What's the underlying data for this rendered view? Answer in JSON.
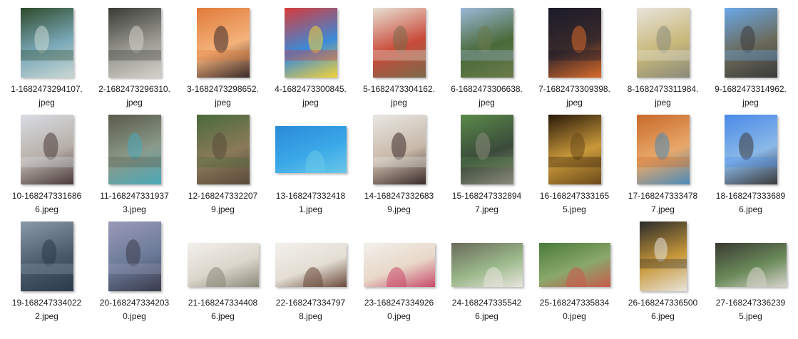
{
  "window": {
    "view": "large-icons"
  },
  "files": [
    {
      "line1": "1-1682473294107.",
      "line2": "jpeg",
      "shape": "portrait",
      "icon": "photo-thumbnail-icon",
      "colors": [
        "#2d4a2a",
        "#7aa8b8",
        "#c9d8d4"
      ]
    },
    {
      "line1": "2-1682473296310.",
      "line2": "jpeg",
      "shape": "portrait",
      "icon": "photo-thumbnail-icon",
      "colors": [
        "#3a3a36",
        "#9a9a92",
        "#d4d2ca"
      ]
    },
    {
      "line1": "3-1682473298652.",
      "line2": "jpeg",
      "shape": "portrait",
      "icon": "photo-thumbnail-icon",
      "colors": [
        "#e07a3a",
        "#f4b27a",
        "#3a2a2a"
      ]
    },
    {
      "line1": "4-1682473300845.",
      "line2": "jpeg",
      "shape": "portrait",
      "icon": "photo-thumbnail-icon",
      "colors": [
        "#d93a3a",
        "#3a8ad9",
        "#f2d23a"
      ]
    },
    {
      "line1": "5-1682473304162.",
      "line2": "jpeg",
      "shape": "portrait",
      "icon": "photo-thumbnail-icon",
      "colors": [
        "#e8e2d4",
        "#c94a3a",
        "#7a6a4a"
      ]
    },
    {
      "line1": "6-1682473306638.",
      "line2": "jpeg",
      "shape": "portrait",
      "icon": "photo-thumbnail-icon",
      "colors": [
        "#9ab8d8",
        "#4a6a3a",
        "#6a7a4a"
      ]
    },
    {
      "line1": "7-1682473309398.",
      "line2": "jpeg",
      "shape": "portrait",
      "icon": "photo-thumbnail-icon",
      "colors": [
        "#1a1a2a",
        "#3a2a2a",
        "#d96a2a"
      ]
    },
    {
      "line1": "8-1682473311984.",
      "line2": "jpeg",
      "shape": "portrait",
      "icon": "photo-thumbnail-icon",
      "colors": [
        "#e8e4dc",
        "#c8b87a",
        "#8a8a7a"
      ]
    },
    {
      "line1": "9-1682473314962.",
      "line2": "jpeg",
      "shape": "portrait",
      "icon": "photo-thumbnail-icon",
      "colors": [
        "#6aa8e8",
        "#6a6a5a",
        "#3a3a3a"
      ]
    },
    {
      "line1": "10-168247331686",
      "line2": "6.jpeg",
      "shape": "portrait",
      "icon": "photo-thumbnail-icon",
      "colors": [
        "#d8dce4",
        "#b8b0a8",
        "#4a3a3a"
      ]
    },
    {
      "line1": "11-168247331937",
      "line2": "3.jpeg",
      "shape": "portrait",
      "icon": "photo-thumbnail-icon",
      "colors": [
        "#5a5a4a",
        "#8a9a8a",
        "#4aa8b8"
      ]
    },
    {
      "line1": "12-168247332207",
      "line2": "9.jpeg",
      "shape": "portrait",
      "icon": "photo-thumbnail-icon",
      "colors": [
        "#4a6a3a",
        "#8a7a5a",
        "#5a4a3a"
      ]
    },
    {
      "line1": "13-168247332418",
      "line2": "1.jpeg",
      "shape": "landscape",
      "icon": "photo-thumbnail-icon",
      "colors": [
        "#2a8ad8",
        "#3aa8e8",
        "#6ac8e8"
      ]
    },
    {
      "line1": "14-168247332683",
      "line2": "9.jpeg",
      "shape": "portrait",
      "icon": "photo-thumbnail-icon",
      "colors": [
        "#e8e8e4",
        "#c8b8a8",
        "#3a2a2a"
      ]
    },
    {
      "line1": "15-168247332894",
      "line2": "7.jpeg",
      "shape": "portrait",
      "icon": "photo-thumbnail-icon",
      "colors": [
        "#5a8a4a",
        "#3a4a3a",
        "#8a8a7a"
      ]
    },
    {
      "line1": "16-168247333165",
      "line2": "5.jpeg",
      "shape": "portrait",
      "icon": "photo-thumbnail-icon",
      "colors": [
        "#2a1a0a",
        "#c8983a",
        "#6a4a1a"
      ]
    },
    {
      "line1": "17-168247333478",
      "line2": "7.jpeg",
      "shape": "portrait",
      "icon": "photo-thumbnail-icon",
      "colors": [
        "#c86a2a",
        "#e8a86a",
        "#4a8ab8"
      ]
    },
    {
      "line1": "18-168247333689",
      "line2": "6.jpeg",
      "shape": "portrait",
      "icon": "photo-thumbnail-icon",
      "colors": [
        "#4a8ae8",
        "#8ab8e8",
        "#3a3a3a"
      ]
    },
    {
      "line1": "19-168247334022",
      "line2": "2.jpeg",
      "shape": "portrait",
      "icon": "photo-thumbnail-icon",
      "colors": [
        "#8a9aa8",
        "#4a5a6a",
        "#2a3a4a"
      ]
    },
    {
      "line1": "20-168247334203",
      "line2": "0.jpeg",
      "shape": "portrait",
      "icon": "photo-thumbnail-icon",
      "colors": [
        "#9a9ab8",
        "#6a7a98",
        "#3a3a4a"
      ]
    },
    {
      "line1": "21-168247334408",
      "line2": "6.jpeg",
      "shape": "landscape-wide",
      "icon": "photo-thumbnail-icon",
      "colors": [
        "#f2f0ec",
        "#dcd6cc",
        "#8a8a7a"
      ]
    },
    {
      "line1": "22-168247334797",
      "line2": "8.jpeg",
      "shape": "landscape-wide",
      "icon": "photo-thumbnail-icon",
      "colors": [
        "#f2f0ec",
        "#e4ded4",
        "#6a4a3a"
      ]
    },
    {
      "line1": "23-168247334926",
      "line2": "0.jpeg",
      "shape": "landscape-wide",
      "icon": "photo-thumbnail-icon",
      "colors": [
        "#f2f0ec",
        "#e8d8c8",
        "#c84a6a"
      ]
    },
    {
      "line1": "24-168247335542",
      "line2": "6.jpeg",
      "shape": "landscape-wide",
      "icon": "photo-thumbnail-icon",
      "colors": [
        "#6a6a5a",
        "#9ab88a",
        "#e8e4dc"
      ]
    },
    {
      "line1": "25-168247335834",
      "line2": "0.jpeg",
      "shape": "landscape-wide",
      "icon": "photo-thumbnail-icon",
      "colors": [
        "#4a7a3a",
        "#8aa86a",
        "#c85a4a"
      ]
    },
    {
      "line1": "26-168247336500",
      "line2": "6.jpeg",
      "shape": "portrait-tall",
      "icon": "photo-thumbnail-icon",
      "colors": [
        "#2a2a2a",
        "#c8983a",
        "#e8e4dc"
      ]
    },
    {
      "line1": "27-168247336239",
      "line2": "5.jpeg",
      "shape": "landscape-wide",
      "icon": "photo-thumbnail-icon",
      "colors": [
        "#3a3a32",
        "#6a8a5a",
        "#d8d4cc"
      ]
    }
  ]
}
